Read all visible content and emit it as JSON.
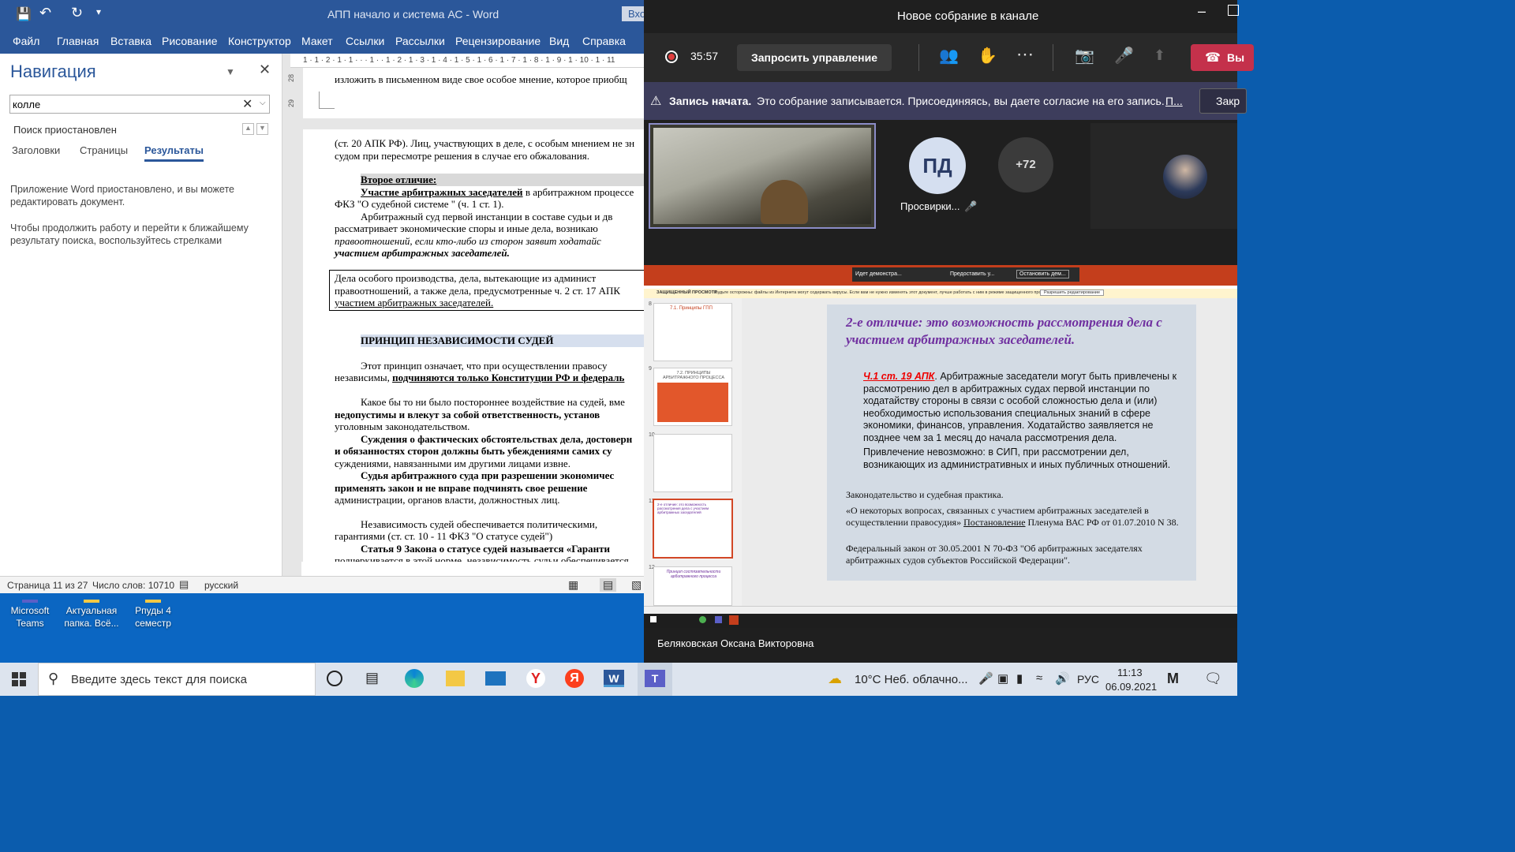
{
  "desktop": {
    "icons": [
      {
        "label": "Microsoft Teams"
      },
      {
        "label": "Актуальная папка. Всё..."
      },
      {
        "label": "Рпуды 4 семестр"
      }
    ]
  },
  "word": {
    "title": "АПП начало и система АС  -  Word",
    "signin": "Вход",
    "tabs": [
      "Файл",
      "Главная",
      "Вставка",
      "Рисование",
      "Конструктор",
      "Макет",
      "Ссылки",
      "Рассылки",
      "Рецензирование",
      "Вид",
      "Справка"
    ],
    "nav": {
      "title": "Навигация",
      "search_value": "колле",
      "search_status": "Поиск приостановлен",
      "subtabs": [
        "Заголовки",
        "Страницы",
        "Результаты"
      ],
      "message1": "Приложение Word приостановлено, и вы можете редактировать документ.",
      "message2": "Чтобы продолжить работу и перейти к ближайшему результату поиска, воспользуйтесь стрелками"
    },
    "ruler": "1 · 1 · 2 · 1 · 1 · · · 1 · · 1 · 2 · 1 · 3 · 1 · 4 · 1 · 5 · 1 · 6 · 1 · 7 · 1 · 8 · 1 · 9 · 1 · 10 · 1 · 11",
    "vruler_marks": [
      "28",
      "29"
    ],
    "page1_line": "изложить в письменном виде свое особое мнение, которое приобщ",
    "doc": {
      "l1": "(ст. 20 АПК РФ). Лиц, участвующих в деле, с особым мнением не зн",
      "l2": "судом при пересмотре решения в случае его обжалования.",
      "h_second": "Второе отличие:",
      "l3a": "Участие арбитражных заседателей",
      "l3b": " в арбитражном процессе",
      "l4": "ФКЗ \"О судебной системе \" (ч. 1 ст. 1).",
      "l5": "Арбитражный суд первой инстанции в составе судьи и дв",
      "l6": "рассматривает экономические споры и иные дела, возникаю",
      "l7": "правоотношений, если кто-либо из сторон заявит ходатайс",
      "l8": "участием арбитражных заседателей.",
      "box1": "Дела особого производства, дела, вытекающие из админист",
      "box2": "правоотношений, а также дела, предусмотренные ч. 2 ст. 17 АПК",
      "box3": "участием арбитражных заседателей.",
      "heading": "ПРИНЦИП НЕЗАВИСИМОСТИ СУДЕЙ",
      "l9": "Этот принцип означает, что при осуществлении правосу",
      "l10a": "независимы, ",
      "l10b": "подчиняются только Конституции РФ и федераль",
      "l11": "Какое бы то ни было постороннее воздействие на судей, вме",
      "l12": "недопустимы и влекут за собой ответственность, установ",
      "l13": "уголовным законодательством.",
      "l14": "Суждения о фактических обстоятельствах дела, достоверн",
      "l15": "и обязанностях сторон должны быть убеждениями самих су",
      "l16": "суждениями, навязанными им другими лицами извне.",
      "l17": "Судья арбитражного суда при разрешении экономичес",
      "l18": "применять закон и не вправе подчинять свое решение",
      "l19": "администрации, органов власти, должностных лиц.",
      "l20": "Независимость судей обеспечивается политическими,",
      "l21": "гарантиями (ст. ст. 10 - 11 ФКЗ \"О статусе судей\")",
      "l22": "Статья 9 Закона о статусе судей называется «Гаранти",
      "l23": "подчеркивается в этой норме, независимость судьи обеспечивается"
    },
    "status": {
      "page": "Страница 11 из 27",
      "words": "Число слов: 10710",
      "lang": "русский"
    }
  },
  "teams": {
    "title": "Новое собрание в канале",
    "timer": "35:57",
    "request_control": "Запросить управление",
    "leave_label": "Вы",
    "banner_bold": "Запись начата.",
    "banner_text": "Это собрание записывается. Присоединяясь, вы даете согласие на его запись.",
    "banner_link": "П...",
    "banner_close": "Закр",
    "participants": [
      {
        "initials": "ПД",
        "name": "Просвирки..."
      },
      {
        "initials": "+72",
        "name": ""
      }
    ],
    "presenter": "Беляковская Оксана Викторовна",
    "share": {
      "pp_topbar": "Идет демонстра...",
      "pp_share": "Предоставить у...",
      "pp_stop": "Остановить дем...",
      "protected": "ЗАЩИЩЕННЫЙ ПРОСМОТР",
      "protected_text": "Будьте осторожны: файлы из Интернета могут содержать вирусы. Если вам не нужно изменять этот документ, лучше работать с ним в режиме защищенного просмотра.",
      "protected_btn": "Разрешить редактирование",
      "slide_title": "2-е отличие: это возможность рассмотрения дела с участием арбитражных заседателей.",
      "slide_red": "Ч.1 ст.  19 АПК",
      "slide_body1": ". Арбитражные заседатели могут быть привлечены к рассмотрению дел в арбитражных судах первой инстанции по ходатайству стороны в связи с особой сложностью дела и (или) необходимостью использования специальных знаний в сфере экономики, финансов, управления. Ходатайство заявляется не позднее чем за 1 месяц до начала рассмотрения дела.",
      "slide_body2": "Привлечение невозможно: в СИП, при рассмотрении дел, возникающих из административных и иных публичных отношений.",
      "slide_law": "Законодательство и судебная практика.",
      "slide_ref1": "«О некоторых вопросах, связанных с участием арбитражных заседателей в осуществлении правосудия»",
      "slide_ref1b": "Постановление",
      "slide_ref1c": " Пленума ВАС РФ от 01.07.2010 N 38.",
      "slide_ref2": "Федеральный закон от 30.05.2001 N 70-ФЗ \"Об арбитражных заседателях арбитражных судов субъектов Российской Федерации\".",
      "thumb_nums": [
        "8",
        "9",
        "10",
        "11",
        "12"
      ],
      "thumb_titles": [
        "7.1. Принципы ГПП",
        "7.2. ПРИНЦИПЫ АРБИТРАЖНОГО ПРОЦЕССА",
        "",
        "2-е отличие: это возможность рассмотрения дела с участием арбитражных заседателей",
        "Принцип состязательности арбитражного процесса"
      ]
    }
  },
  "taskbar": {
    "search_placeholder": "Введите здесь текст для поиска",
    "weather": "10°C  Неб. облачно...",
    "lang": "РУС",
    "time": "11:13",
    "date": "06.09.2021"
  }
}
